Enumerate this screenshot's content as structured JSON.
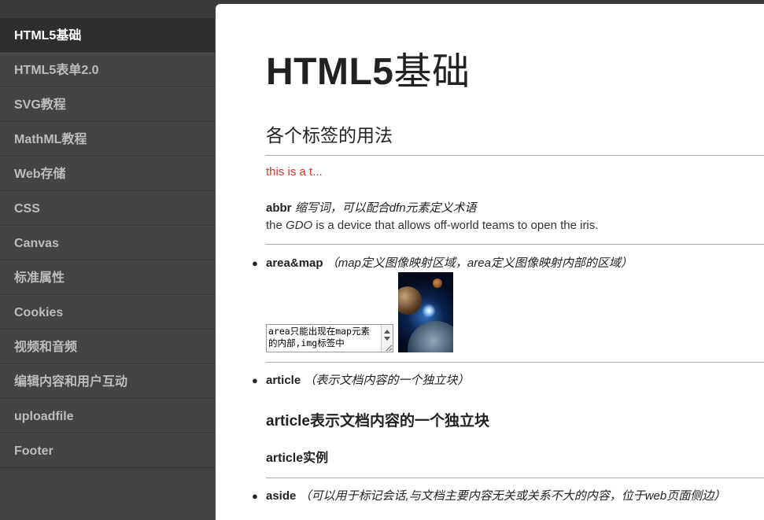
{
  "sidebar": {
    "items": [
      {
        "label": "HTML5基础",
        "active": true
      },
      {
        "label": "HTML5表单2.0"
      },
      {
        "label": "SVG教程"
      },
      {
        "label": "MathML教程"
      },
      {
        "label": "Web存储"
      },
      {
        "label": "CSS"
      },
      {
        "label": "Canvas"
      },
      {
        "label": "标准属性"
      },
      {
        "label": "Cookies"
      },
      {
        "label": "视频和音频"
      },
      {
        "label": "编辑内容和用户互动"
      },
      {
        "label": "uploadfile"
      },
      {
        "label": "Footer"
      }
    ]
  },
  "main": {
    "title_latin": "HTML5",
    "title_cjk": "基础",
    "section_title": "各个标签的用法",
    "red_text": "this is a t...",
    "abbr": {
      "tag": "abbr",
      "desc": "缩写词，可以配合dfn元素定义术语",
      "sentence_before": "the ",
      "sentence_abbr": "GDO",
      "sentence_after": " is a device that allows off-world teams to open the iris."
    },
    "area_map": {
      "tag": "area&map",
      "desc": "（map定义图像映射区域，area定义图像映射内部的区域）",
      "textarea_value": "area只能出现在map元素的内部,img标签中"
    },
    "article": {
      "tag": "article",
      "desc": "（表示文档内容的一个独立块）",
      "h3": "article表示文档内容的一个独立块",
      "h4": "article实例"
    },
    "aside": {
      "tag": "aside",
      "desc": "（可以用于标记会话,与文档主要内容无关或关系不大的内容，位于web页面侧边）"
    }
  },
  "colors": {
    "sidebar_bg": "#444444",
    "sidebar_active_bg": "#2e2e2e",
    "sidebar_text": "#bdbdbd",
    "red_text": "#d9342b"
  }
}
